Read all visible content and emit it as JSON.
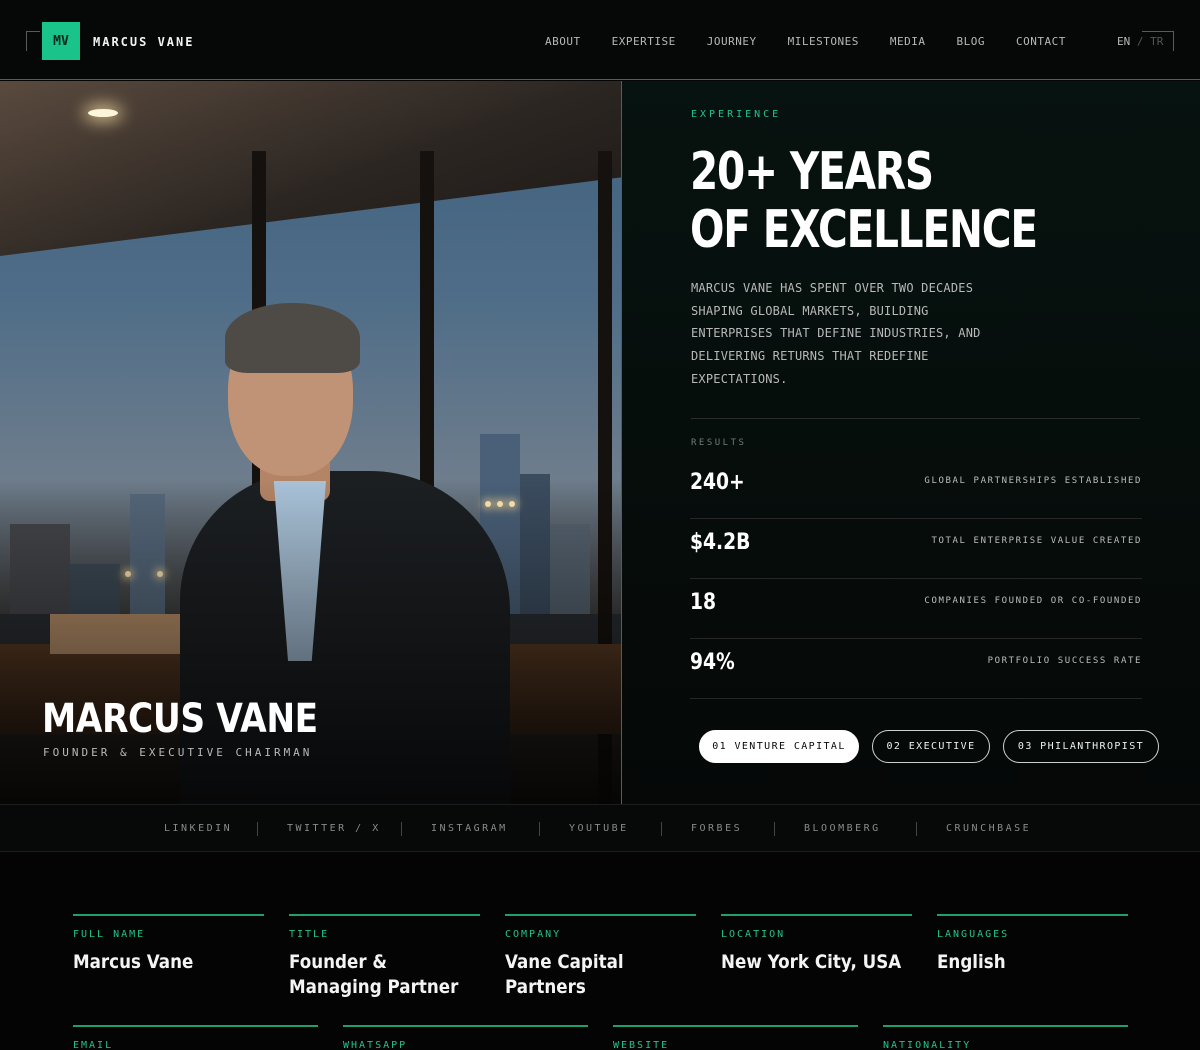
{
  "nav": {
    "logo_mark": "MV",
    "logo_text": "MARCUS VANE",
    "links": [
      "ABOUT",
      "EXPERTISE",
      "JOURNEY",
      "MILESTONES",
      "MEDIA",
      "BLOG",
      "CONTACT"
    ],
    "lang_active": "EN",
    "lang_sep": " / ",
    "lang_other": "TR"
  },
  "hero": {
    "name": "MARCUS VANE",
    "subtitle": "FOUNDER & EXECUTIVE CHAIRMAN",
    "eyebrow": "EXPERIENCE",
    "headline_line1": "20+ YEARS",
    "headline_line2": "OF EXCELLENCE",
    "lead": "MARCUS VANE HAS SPENT OVER TWO DECADES SHAPING GLOBAL MARKETS, BUILDING ENTERPRISES THAT DEFINE INDUSTRIES, AND DELIVERING RETURNS THAT REDEFINE EXPECTATIONS.",
    "results_label": "RESULTS",
    "stats": [
      {
        "value": "240+",
        "label": "GLOBAL PARTNERSHIPS ESTABLISHED"
      },
      {
        "value": "$4.2B",
        "label": "TOTAL ENTERPRISE VALUE CREATED"
      },
      {
        "value": "18",
        "label": "COMPANIES FOUNDED OR CO-FOUNDED"
      },
      {
        "value": "94%",
        "label": "PORTFOLIO SUCCESS RATE"
      }
    ],
    "pills": [
      {
        "label": "01  VENTURE CAPITAL",
        "active": true
      },
      {
        "label": "02  EXECUTIVE",
        "active": false
      },
      {
        "label": "03  PHILANTHROPIST",
        "active": false
      }
    ]
  },
  "social": [
    "LINKEDIN",
    "TWITTER / X",
    "INSTAGRAM",
    "YOUTUBE",
    "FORBES",
    "BLOOMBERG",
    "CRUNCHBASE"
  ],
  "info": {
    "row1": [
      {
        "key": "FULL NAME",
        "value": "Marcus Vane"
      },
      {
        "key": "TITLE",
        "value": "Founder & Managing Partner"
      },
      {
        "key": "COMPANY",
        "value": "Vane Capital Partners"
      },
      {
        "key": "LOCATION",
        "value": "New York City, USA"
      },
      {
        "key": "LANGUAGES",
        "value": "English"
      }
    ],
    "row2": [
      {
        "key": "EMAIL",
        "value": ""
      },
      {
        "key": "WHATSAPP",
        "value": ""
      },
      {
        "key": "WEBSITE",
        "value": ""
      },
      {
        "key": "NATIONALITY",
        "value": ""
      }
    ]
  },
  "colors": {
    "accent": "#19c38a",
    "background": "#050505",
    "pill_active": "#ffffff"
  }
}
